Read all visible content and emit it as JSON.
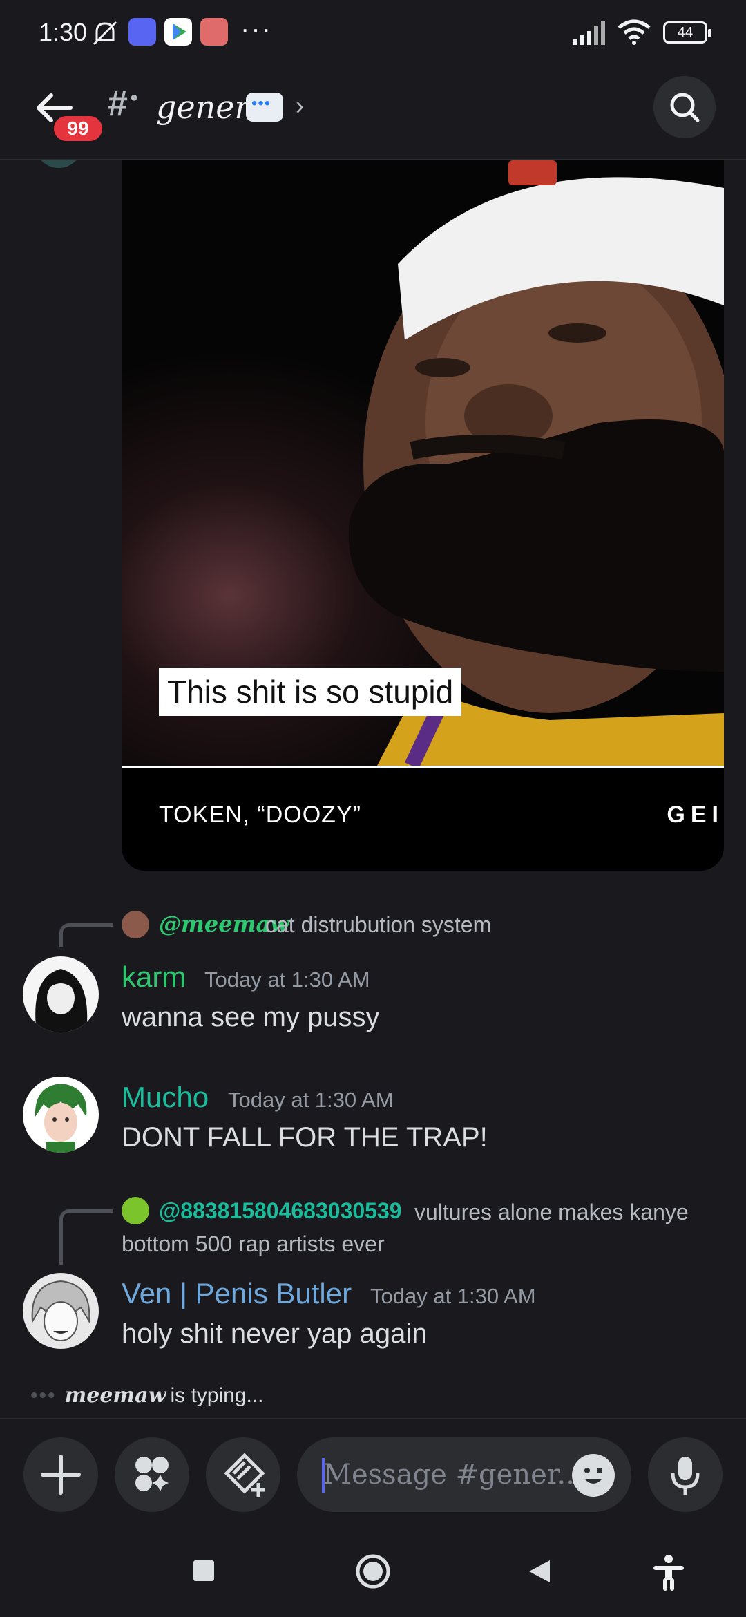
{
  "status_bar": {
    "time": "1:30",
    "more_dots": "···",
    "battery": "44"
  },
  "header": {
    "unread_count": "99",
    "channel_hash": "#",
    "channel_name": "general",
    "chevron": "›"
  },
  "embed": {
    "caption": "This shit is so stupid",
    "footer_title": "TOKEN, “DOOZY”",
    "footer_right": "GEI"
  },
  "messages": [
    {
      "reply": {
        "mention": "@meemaw",
        "text": "cat distrubution system",
        "mention_color": "#2dc770"
      },
      "username": "karm",
      "username_color": "#2dc770",
      "timestamp": "Today at 1:30 AM",
      "text": "wanna see my pussy"
    },
    {
      "username": "Mucho",
      "username_color": "#1abc9c",
      "timestamp": "Today at 1:30 AM",
      "text": "DONT FALL FOR THE TRAP!"
    },
    {
      "reply": {
        "mention": "@883815804683030539",
        "text": "vultures alone makes kanye",
        "text_line2": "bottom 500 rap artists ever",
        "mention_color": "#1abc9c"
      },
      "username": "Ven | Penis Butler",
      "username_color": "#6fa8dc",
      "timestamp": "Today at 1:30 AM",
      "text": "holy shit never yap again"
    }
  ],
  "typing": {
    "dots": "•••",
    "name": "meemaw",
    "suffix": "is typing..."
  },
  "composer": {
    "placeholder": "Message #gener..."
  }
}
